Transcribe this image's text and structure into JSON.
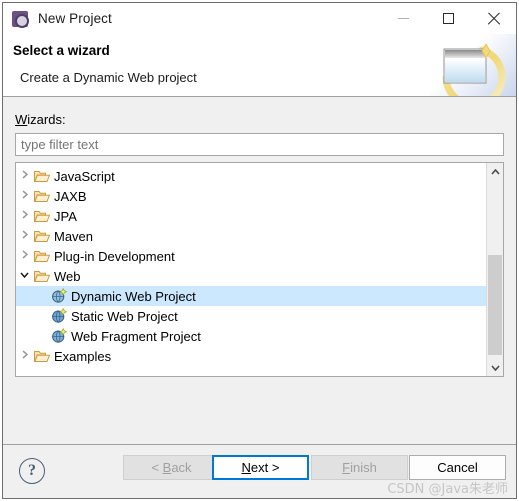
{
  "window": {
    "title": "New Project",
    "icon": "eclipse-wizard-icon",
    "controls": {
      "minimize": "minimize-icon",
      "maximize": "maximize-icon",
      "close": "close-icon"
    }
  },
  "header": {
    "title": "Select a wizard",
    "subtitle": "Create a Dynamic Web project",
    "banner_icon": "new-web-project-banner"
  },
  "main": {
    "wizards_label_mnemonic": "W",
    "wizards_label_rest": "izards:",
    "filter": {
      "value": "",
      "placeholder": "type filter text"
    },
    "tree": [
      {
        "label": "JavaScript",
        "icon": "folder-icon",
        "state": "collapsed",
        "depth": 0,
        "selected": false
      },
      {
        "label": "JAXB",
        "icon": "folder-icon",
        "state": "collapsed",
        "depth": 0,
        "selected": false
      },
      {
        "label": "JPA",
        "icon": "folder-icon",
        "state": "collapsed",
        "depth": 0,
        "selected": false
      },
      {
        "label": "Maven",
        "icon": "folder-icon",
        "state": "collapsed",
        "depth": 0,
        "selected": false
      },
      {
        "label": "Plug-in Development",
        "icon": "folder-icon",
        "state": "collapsed",
        "depth": 0,
        "selected": false
      },
      {
        "label": "Web",
        "icon": "folder-icon",
        "state": "expanded",
        "depth": 0,
        "selected": false
      },
      {
        "label": "Dynamic Web Project",
        "icon": "dynamic-web-project-icon",
        "state": "leaf",
        "depth": 1,
        "selected": true
      },
      {
        "label": "Static Web Project",
        "icon": "static-web-project-icon",
        "state": "leaf",
        "depth": 1,
        "selected": false
      },
      {
        "label": "Web Fragment Project",
        "icon": "web-fragment-project-icon",
        "state": "leaf",
        "depth": 1,
        "selected": false
      },
      {
        "label": "Examples",
        "icon": "folder-icon",
        "state": "collapsed",
        "depth": 0,
        "selected": false
      }
    ],
    "scrollbar": {
      "up_arrow": "chevron-up-icon",
      "down_arrow": "chevron-down-icon"
    }
  },
  "footer": {
    "help_icon": "help-icon",
    "help_glyph": "?",
    "buttons": [
      {
        "name": "back",
        "prefix": "< ",
        "mnemonic": "B",
        "rest": "ack",
        "suffix": "",
        "disabled": true,
        "focused": false
      },
      {
        "name": "next",
        "prefix": "",
        "mnemonic": "N",
        "rest": "ext",
        "suffix": " >",
        "disabled": false,
        "focused": true
      },
      {
        "name": "finish",
        "prefix": "",
        "mnemonic": "F",
        "rest": "inish",
        "suffix": "",
        "disabled": true,
        "focused": false
      },
      {
        "name": "cancel",
        "prefix": "",
        "mnemonic": "",
        "rest": "Cancel",
        "suffix": "",
        "disabled": false,
        "focused": false
      }
    ]
  },
  "watermark": "CSDN @Java朱老师",
  "colors": {
    "selection": "#cce8ff",
    "focus_border": "#0078d7",
    "dialog_bg": "#f0f0f0",
    "folder": "#e8a33d"
  }
}
